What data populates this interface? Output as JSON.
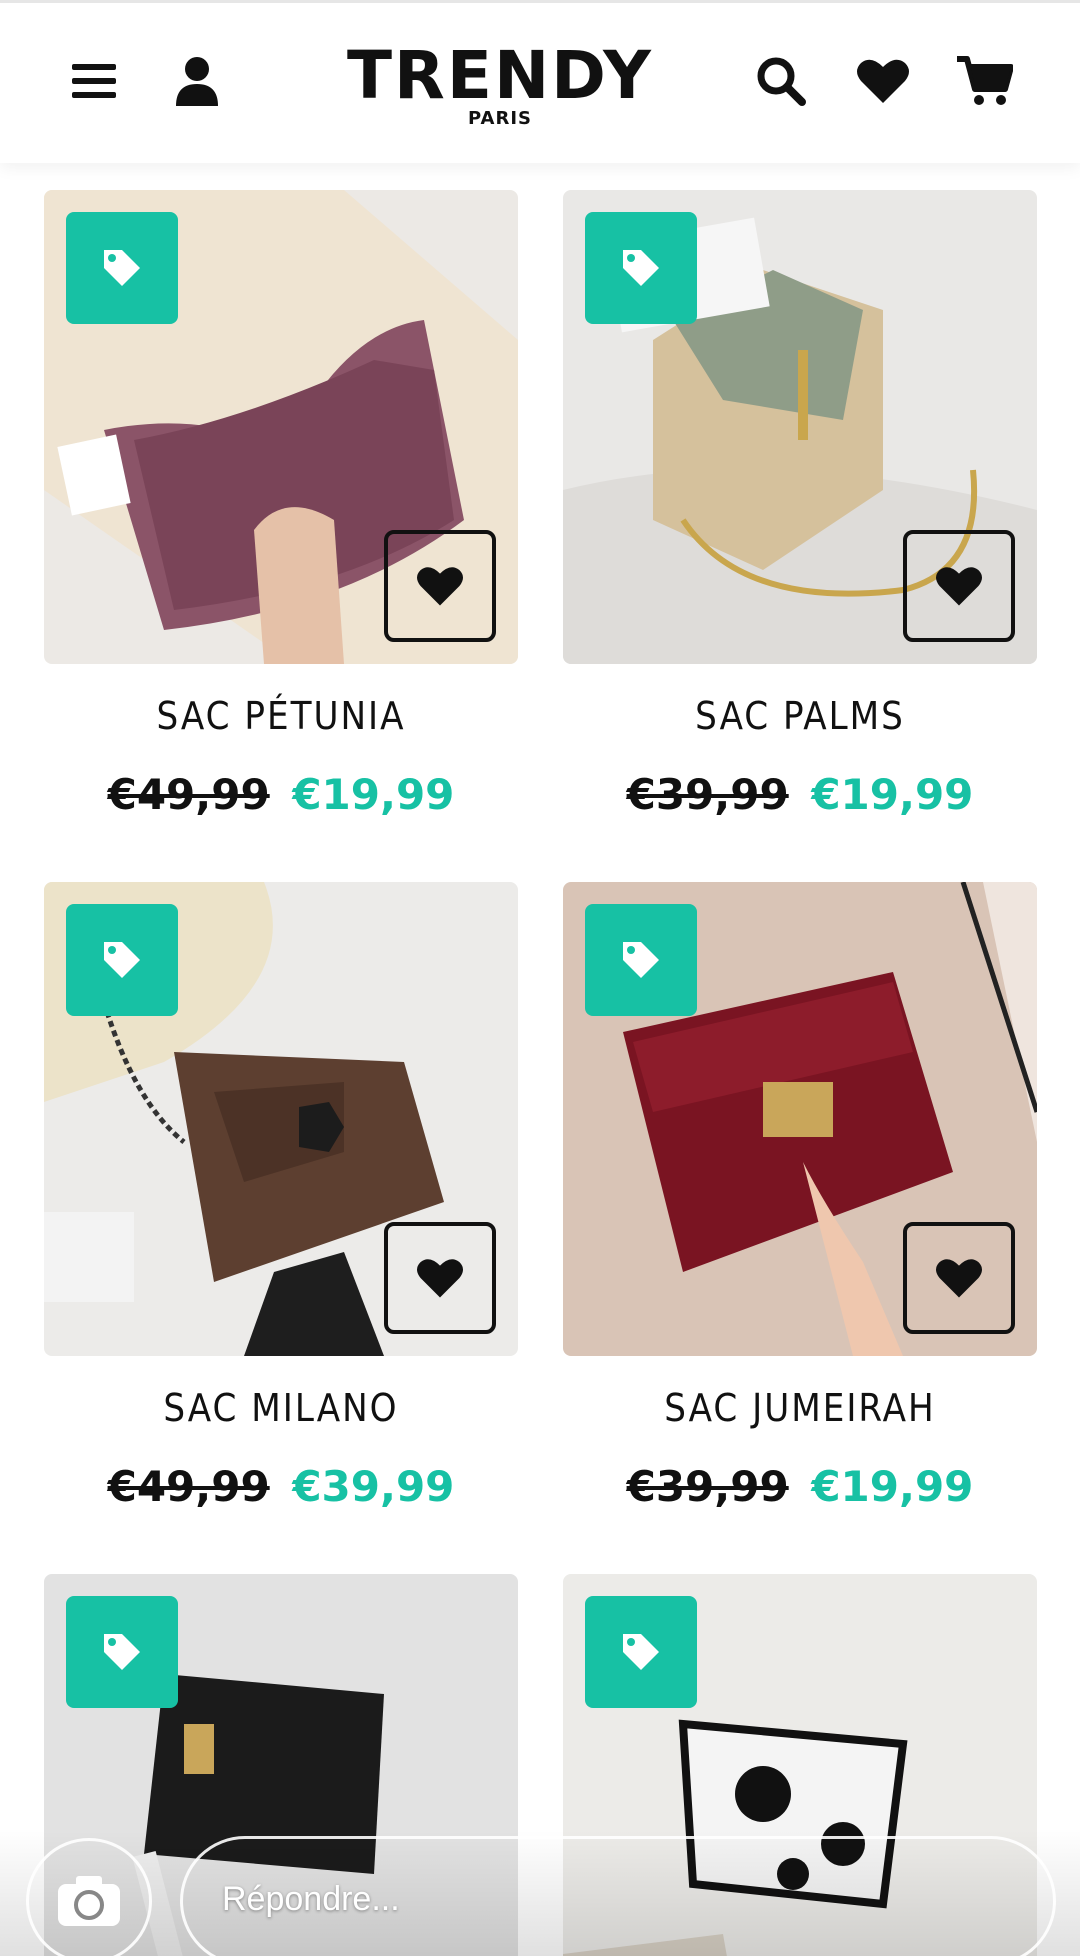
{
  "header": {
    "brand": "TRENDY",
    "city": "PARIS",
    "icons": [
      "menu-icon",
      "user-icon",
      "search-icon",
      "heart-icon",
      "cart-icon"
    ]
  },
  "colors": {
    "accent": "#17c1a4",
    "text": "#111111"
  },
  "products": [
    {
      "name": "SAC PÉTUNIA",
      "old_price": "€49,99",
      "new_price": "€19,99"
    },
    {
      "name": "SAC PALMS",
      "old_price": "€39,99",
      "new_price": "€19,99"
    },
    {
      "name": "SAC MILANO",
      "old_price": "€49,99",
      "new_price": "€39,99"
    },
    {
      "name": "SAC JUMEIRAH",
      "old_price": "€39,99",
      "new_price": "€19,99"
    }
  ],
  "bottom_bar": {
    "reply_placeholder": "Répondre..."
  }
}
